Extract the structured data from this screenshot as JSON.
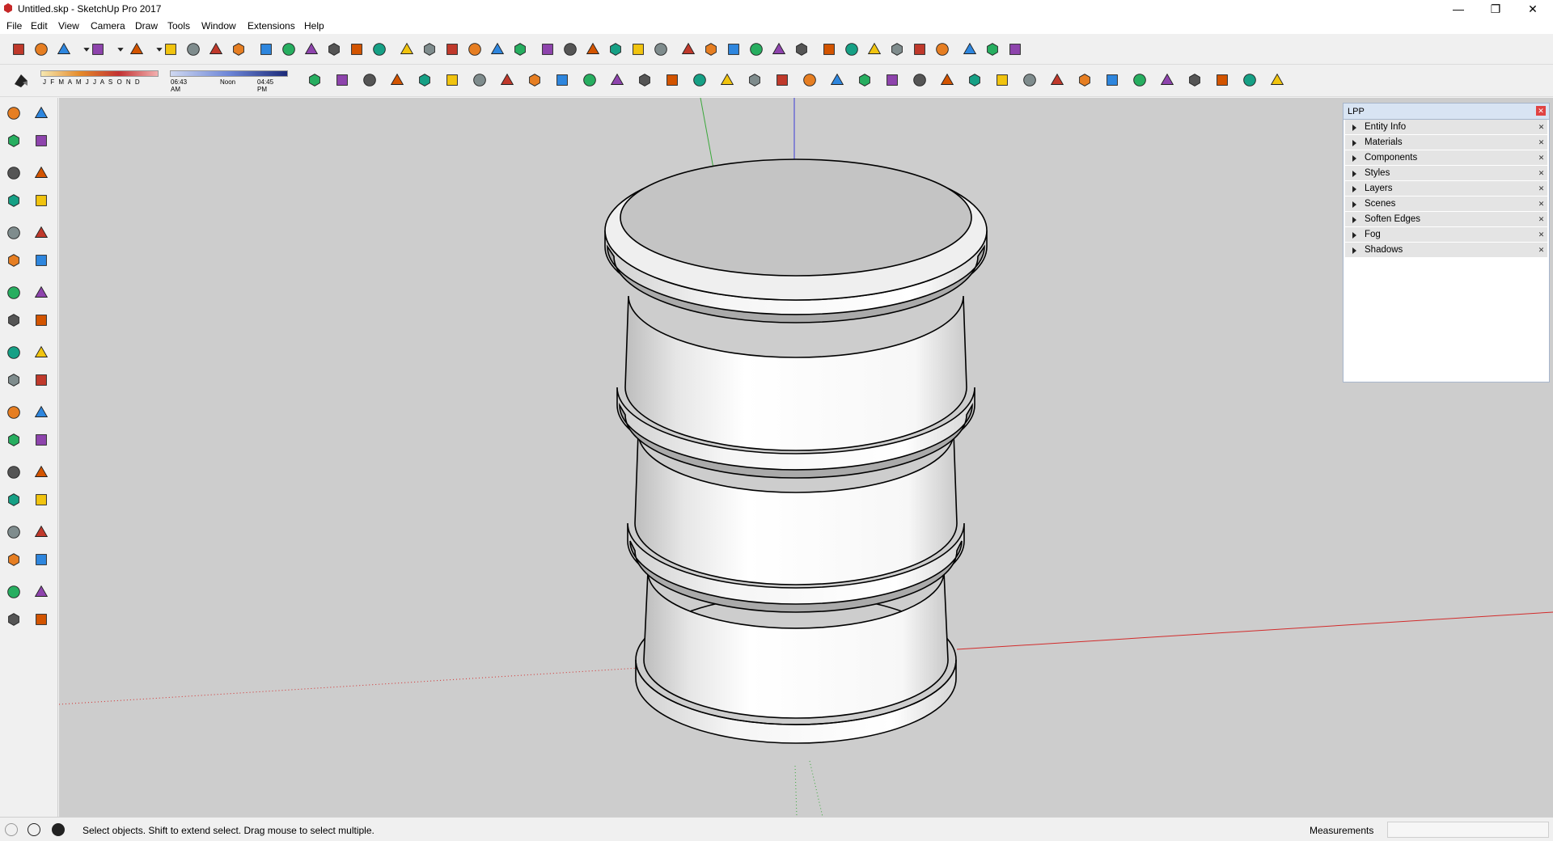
{
  "window": {
    "title": "Untitled.skp - SketchUp Pro 2017",
    "minimize": "—",
    "restore": "❐",
    "close": "✕"
  },
  "menu": [
    "File",
    "Edit",
    "View",
    "Camera",
    "Draw",
    "Tools",
    "Window",
    "Extensions",
    "Help"
  ],
  "shadows": {
    "months": "J F M A M J J A S O N D",
    "time_start": "06:43 AM",
    "time_mid": "Noon",
    "time_end": "04:45 PM"
  },
  "tray": {
    "title": "LPP",
    "panels": [
      "Entity Info",
      "Materials",
      "Components",
      "Styles",
      "Layers",
      "Scenes",
      "Soften Edges",
      "Fog",
      "Shadows"
    ]
  },
  "status": {
    "hint": "Select objects. Shift to extend select. Drag mouse to select multiple.",
    "measurements_label": "Measurements",
    "measurements_value": ""
  },
  "colors": {
    "viewport": "#cdcdcd",
    "axis_red": "#d22b2b",
    "axis_green": "#3aa83a",
    "axis_blue": "#3b3bd6",
    "tray_header": "#d8e4f3"
  },
  "icons": {
    "toolbar1": [
      "select-icon",
      "eraser-icon",
      "pencil-icon",
      "dropdown-arrow-icon",
      "arc-icon",
      "dropdown-arrow-icon",
      "circle-icon",
      "dropdown-arrow-icon",
      "push-pull-icon",
      "follow-me-icon",
      "move-icon",
      "rotate-icon",
      "scale-icon",
      "tape-measure-icon",
      "text-icon",
      "paint-bucket-icon",
      "orbit-icon",
      "pan-icon",
      "zoom-icon",
      "zoom-extents-icon",
      "warehouse-icon",
      "extension-warehouse-icon",
      "send-to-layout-icon",
      "ruby-icon",
      "make-component-icon",
      "outer-shell-icon",
      "intersect-icon",
      "union-icon",
      "subtract-icon",
      "trim-icon",
      "red-cube-icon",
      "blue-cube-icon",
      "gray-cube-icon",
      "section-plane-icon",
      "power-icon",
      "sun-icon",
      "pencil-edit-icon",
      "paint-icon",
      "binoculars-icon",
      "position-camera-icon",
      "walk-icon",
      "look-around-icon",
      "map-icon",
      "tag-icon",
      "download-icon"
    ],
    "toolbar2": [
      "style-icon",
      "iso-view-icon",
      "top-view-icon",
      "front-view-icon",
      "right-view-icon",
      "back-view-icon",
      "left-view-icon",
      "hidden-line-icon",
      "shaded-icon",
      "textured-icon",
      "mono-icon",
      "xray-icon",
      "back-edges-icon",
      "wireframe-icon",
      "profile-icon",
      "depth-cue-icon",
      "extension-icon",
      "axes-icon",
      "guides-icon",
      "section-cut-icon",
      "undo-icon",
      "redo-icon",
      "sandbox-icon",
      "smoove-icon",
      "stamp-icon",
      "drape-icon",
      "add-detail-icon",
      "flip-edge-icon",
      "solid-tools-icon",
      "soften-icon",
      "shadow-icon",
      "fog-icon",
      "component-icon",
      "dynamic-icon",
      "geo-icon",
      "settings-icon",
      "help-icon"
    ],
    "lefttools": [
      "select-icon",
      "component-icon",
      "paint-bucket-icon",
      "eraser-icon",
      "line-icon",
      "freehand-icon",
      "rectangle-icon",
      "rotated-rectangle-icon",
      "circle-icon",
      "polygon-icon",
      "arc-icon",
      "two-point-arc-icon",
      "pie-icon",
      "three-point-arc-icon",
      "move-icon",
      "push-pull-icon",
      "rotate-icon",
      "follow-me-icon",
      "scale-icon",
      "offset-icon",
      "tape-measure-icon",
      "dimension-icon",
      "protractor-icon",
      "text-icon",
      "axes-icon",
      "3d-text-icon",
      "orbit-icon",
      "pan-icon",
      "zoom-icon",
      "zoom-window-icon",
      "zoom-extents-icon",
      "previous-view-icon",
      "position-camera-icon",
      "look-around-icon",
      "walk-icon",
      "section-plane-icon"
    ]
  }
}
